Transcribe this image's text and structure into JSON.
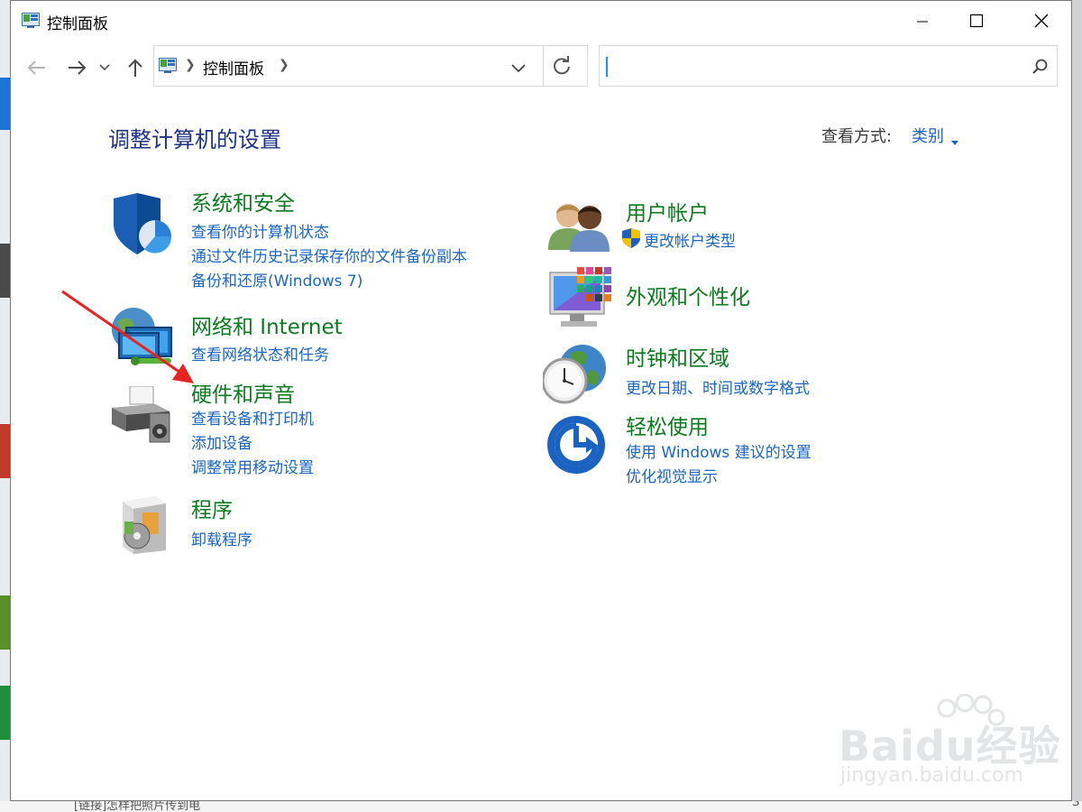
{
  "window": {
    "title": "控制面板"
  },
  "address_bar": {
    "crumb": "控制面板"
  },
  "search": {
    "placeholder": "",
    "value": ""
  },
  "header": {
    "title": "调整计算机的设置",
    "view_by_label": "查看方式:",
    "view_by_value": "类别"
  },
  "categories": {
    "system": {
      "title": "系统和安全",
      "links": [
        "查看你的计算机状态",
        "通过文件历史记录保存你的文件备份副本",
        "备份和还原(Windows 7)"
      ]
    },
    "network": {
      "title": "网络和 Internet",
      "links": [
        "查看网络状态和任务"
      ]
    },
    "hardware": {
      "title": "硬件和声音",
      "links": [
        "查看设备和打印机",
        "添加设备",
        "调整常用移动设置"
      ]
    },
    "programs": {
      "title": "程序",
      "links": [
        "卸载程序"
      ]
    },
    "accounts": {
      "title": "用户帐户",
      "links": [
        "更改帐户类型"
      ]
    },
    "appearance": {
      "title": "外观和个性化",
      "links": []
    },
    "clock": {
      "title": "时钟和区域",
      "links": [
        "更改日期、时间或数字格式"
      ]
    },
    "ease": {
      "title": "轻松使用",
      "links": [
        "使用 Windows 建议的设置",
        "优化视觉显示"
      ]
    }
  },
  "background": {
    "bottom_left_text": "[链接]怎样把照片传到电",
    "bottom_right_text": "S"
  },
  "watermark": {
    "brand": "Baidu经验",
    "url": "jingyan.baidu.com"
  },
  "colors": {
    "link": "#1a66c2",
    "category_title": "#0e7a1f",
    "page_title": "#1e3287",
    "annotation": "#e8231f"
  }
}
